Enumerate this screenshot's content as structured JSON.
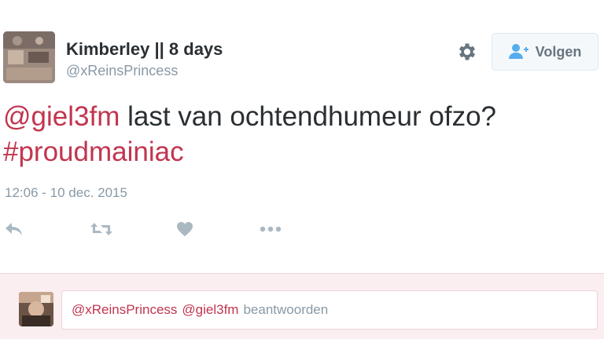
{
  "tweet": {
    "author_name": "Kimberley || 8 days",
    "handle": "@xReinsPrincess",
    "follow_label": "Volgen",
    "text": {
      "mention": "@giel3fm",
      "body": " last van ochtendhumeur ofzo?",
      "hashtag": "#proudmainiac"
    },
    "timestamp": "12:06 - 10 dec. 2015"
  },
  "actions": [
    {
      "name": "reply",
      "icon": "reply-icon"
    },
    {
      "name": "retweet",
      "icon": "retweet-icon"
    },
    {
      "name": "like",
      "icon": "heart-icon"
    },
    {
      "name": "more",
      "icon": "more-icon"
    }
  ],
  "reply_box": {
    "mention_1": "@xReinsPrincess",
    "mention_2": "@giel3fm",
    "placeholder": "beantwoorden"
  },
  "colors": {
    "accent": "#c2354f",
    "muted": "#8899a6",
    "text": "#292f33",
    "reply_bg": "#fbeef0"
  }
}
